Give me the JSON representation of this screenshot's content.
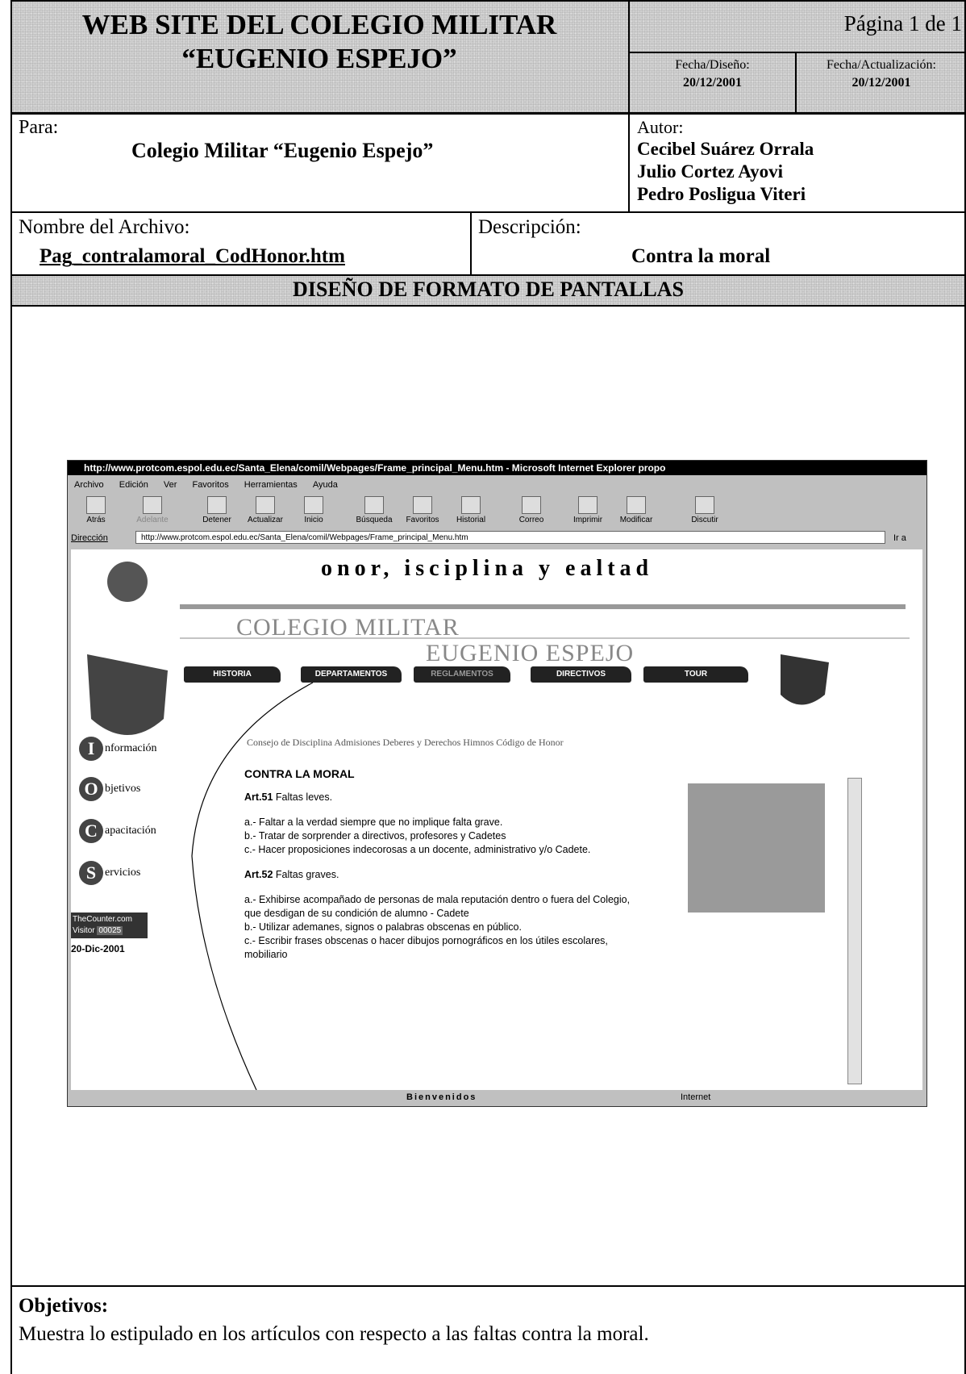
{
  "header": {
    "title_line1": "WEB SITE DEL COLEGIO MILITAR",
    "title_line2": "“EUGENIO ESPEJO”",
    "page": "Página 1 de 1",
    "fecha_diseno_label": "Fecha/Diseño:",
    "fecha_diseno": "20/12/2001",
    "fecha_act_label": "Fecha/Actualización:",
    "fecha_act": "20/12/2001"
  },
  "para": {
    "label": "Para:",
    "value": "Colegio Militar “Eugenio Espejo”"
  },
  "autor": {
    "label": "Autor:",
    "names": [
      "Cecibel Suárez Orrala",
      "Julio Cortez Ayovi",
      "Pedro Posligua Viteri"
    ]
  },
  "archivo": {
    "label": "Nombre del Archivo:",
    "value": "Pag_contralamoral_CodHonor.htm"
  },
  "descripcion": {
    "label": "Descripción:",
    "value": "Contra la moral"
  },
  "section_title": "DISEÑO DE FORMATO DE PANTALLAS",
  "browser": {
    "title": "http://www.protcom.espol.edu.ec/Santa_Elena/comil/Webpages/Frame_principal_Menu.htm - Microsoft Internet Explorer propo",
    "menu": [
      "Archivo",
      "Edición",
      "Ver",
      "Favoritos",
      "Herramientas",
      "Ayuda"
    ],
    "toolbar": [
      "Atrás",
      "Adelante",
      "Detener",
      "Actualizar",
      "Inicio",
      "Búsqueda",
      "Favoritos",
      "Historial",
      "Correo",
      "Imprimir",
      "Modificar",
      "Discutir"
    ],
    "address_label": "Dirección",
    "address": "http://www.protcom.espol.edu.ec/Santa_Elena/comil/Webpages/Frame_principal_Menu.htm",
    "go": "Ir a",
    "status_text": "Bienvenidos",
    "zone": "Internet"
  },
  "site": {
    "motto": "onor, isciplina y ealtad",
    "colegio1": "COLEGIO MILITAR",
    "colegio2": "EUGENIO ESPEJO",
    "nav": [
      "HISTORIA",
      "DEPARTAMENTOS",
      "REGLAMENTOS",
      "DIRECTIVOS",
      "TOUR"
    ],
    "left": [
      {
        "letter": "I",
        "text": "nformación"
      },
      {
        "letter": "O",
        "text": "bjetivos"
      },
      {
        "letter": "C",
        "text": "apacitación"
      },
      {
        "letter": "S",
        "text": "ervicios"
      }
    ],
    "counter": "TheCounter.com",
    "counter_visitor": "Visitor",
    "counter_value": "00025",
    "date": "20-Dic-2001",
    "subnav": "Consejo de Disciplina    Admisiones    Deberes y Derechos  Himnos    Código de Honor",
    "content_title": "CONTRA LA MORAL",
    "art51_b": "Art.51",
    "art51": " Faltas leves.",
    "art51_items": [
      "a.- Faltar a la verdad siempre que no implique falta grave.",
      "b.- Tratar de sorprender a directivos, profesores y Cadetes",
      "c.- Hacer proposiciones indecorosas a un docente, administrativo y/o Cadete."
    ],
    "art52_b": "Art.52",
    "art52": " Faltas graves.",
    "art52_items": [
      "a.- Exhibirse acompañado de personas de mala reputación dentro o fuera del Colegio, que desdigan de su condición de alumno - Cadete",
      "b.- Utilizar ademanes, signos o palabras obscenas en público.",
      "c.- Escribir frases obscenas o hacer dibujos pornográficos en los útiles escolares, mobiliario"
    ]
  },
  "objetivos": {
    "label": "Objetivos:",
    "text": "Muestra lo estipulado en los artículos con respecto a las faltas contra la moral."
  }
}
